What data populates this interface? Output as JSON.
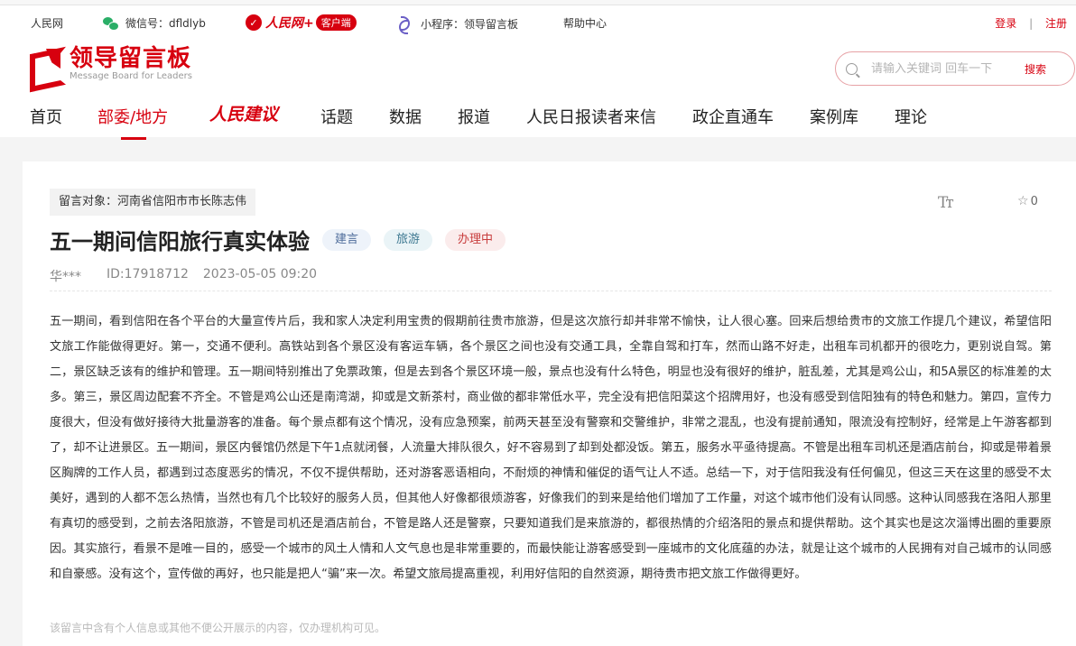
{
  "topbar": {
    "site": "人民网",
    "wechat_label": "微信号：dfldlyb",
    "rmw_brand": "人民网+",
    "rmw_client": "客户端",
    "miniprogram": "小程序：领导留言板",
    "help": "帮助中心",
    "login": "登录",
    "separator": "|",
    "register": "注册"
  },
  "logo": {
    "title": "领导留言板",
    "subtitle": "Message Board for Leaders"
  },
  "search": {
    "placeholder": "请输入关键词 回车一下",
    "button": "搜索"
  },
  "nav": {
    "items": [
      {
        "label": "首页"
      },
      {
        "label": "部委/地方"
      },
      {
        "label": "人民建议"
      },
      {
        "label": "话题"
      },
      {
        "label": "数据"
      },
      {
        "label": "报道"
      },
      {
        "label": "人民日报读者来信"
      },
      {
        "label": "政企直通车"
      },
      {
        "label": "案例库"
      },
      {
        "label": "理论"
      }
    ],
    "active_index": 1
  },
  "message": {
    "target": "留言对象：河南省信阳市市长陈志伟",
    "title": "五一期间信阳旅行真实体验",
    "tags": [
      "建言",
      "旅游",
      "办理中"
    ],
    "author": "华***",
    "id": "ID:17918712",
    "date": "2023-05-05 09:20",
    "font_toggle": "Tт",
    "favorites": "0",
    "content": "五一期间，看到信阳在各个平台的大量宣传片后，我和家人决定利用宝贵的假期前往贵市旅游，但是这次旅行却并非常不愉快，让人很心塞。回来后想给贵市的文旅工作提几个建议，希望信阳文旅工作能做得更好。第一，交通不便利。高铁站到各个景区没有客运车辆，各个景区之间也没有交通工具，全靠自驾和打车，然而山路不好走，出租车司机都开的很吃力，更别说自驾。第二，景区缺乏该有的维护和管理。五一期间特别推出了免票政策，但是去到各个景区环境一般，景点也没有什么特色，明显也没有很好的维护，脏乱差，尤其是鸡公山，和5A景区的标准差的太多。第三，景区周边配套不齐全。不管是鸡公山还是南湾湖，抑或是文新茶村，商业做的都非常低水平，完全没有把信阳菜这个招牌用好，也没有感受到信阳独有的特色和魅力。第四，宣传力度很大，但没有做好接待大批量游客的准备。每个景点都有这个情况，没有应急预案，前两天甚至没有警察和交警维护，非常之混乱，也没有提前通知，限流没有控制好，经常是上午游客都到了，却不让进景区。五一期间，景区内餐馆仍然是下午1点就闭餐，人流量大排队很久，好不容易到了却到处都没饭。第五，服务水平亟待提高。不管是出租车司机还是酒店前台，抑或是带着景区胸牌的工作人员，都遇到过态度恶劣的情况，不仅不提供帮助，还对游客恶语相向，不耐烦的神情和催促的语气让人不适。总结一下，对于信阳我没有任何偏见，但这三天在这里的感受不太美好，遇到的人都不怎么热情，当然也有几个比较好的服务人员，但其他人好像都很烦游客，好像我们的到来是给他们增加了工作量，对这个城市他们没有认同感。这种认同感我在洛阳人那里有真切的感受到，之前去洛阳旅游，不管是司机还是酒店前台，不管是路人还是警察，只要知道我们是来旅游的，都很热情的介绍洛阳的景点和提供帮助。这个其实也是这次淄博出圈的重要原因。其实旅行，看景不是唯一目的，感受一个城市的风土人情和人文气息也是非常重要的，而最快能让游客感受到一座城市的文化底蕴的办法，就是让这个城市的人民拥有对自己城市的认同感和自豪感。没有这个，宣传做的再好，也只能是把人“骗”来一次。希望文旅局提高重视，利用好信阳的自然资源，期待贵市把文旅工作做得更好。",
    "privacy_note": "该留言中含有个人信息或其他不便公开展示的内容，仅办理机构可见。"
  }
}
